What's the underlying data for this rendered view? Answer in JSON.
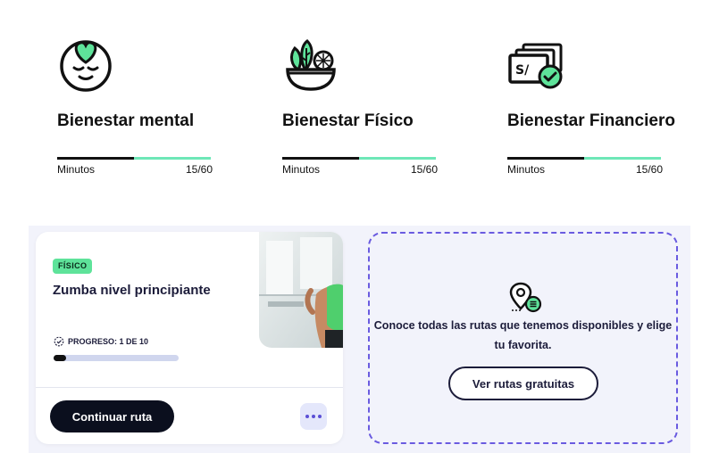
{
  "wellness": [
    {
      "icon": "happy-face-heart-icon",
      "title": "Bienestar mental",
      "label": "Minutos",
      "value": "15/60",
      "progress": 0.5
    },
    {
      "icon": "salad-bowl-icon",
      "title": "Bienestar Físico",
      "label": "Minutos",
      "value": "15/60",
      "progress": 0.5
    },
    {
      "icon": "money-check-icon",
      "title": "Bienestar Financiero",
      "label": "Minutos",
      "value": "15/60",
      "progress": 0.5
    }
  ],
  "course": {
    "badge": "FÍSICO",
    "title": "Zumba nivel principiante",
    "progress_label": "PROGRESO: 1 DE 10",
    "progress": 0.1,
    "continue_label": "Continuar ruta",
    "more_icon": "more-dots-icon"
  },
  "routes": {
    "description": "Conoce todas las rutas que tenemos disponibles y elige tu favorita.",
    "button_label": "Ver rutas gratuitas",
    "icon": "route-pin-list-icon"
  },
  "colors": {
    "accent_green": "#5ee39a",
    "bar_light": "#6ee7b7",
    "dark": "#0b0f1e",
    "purple": "#6a5be0",
    "panel_bg": "#f2f3fb"
  }
}
